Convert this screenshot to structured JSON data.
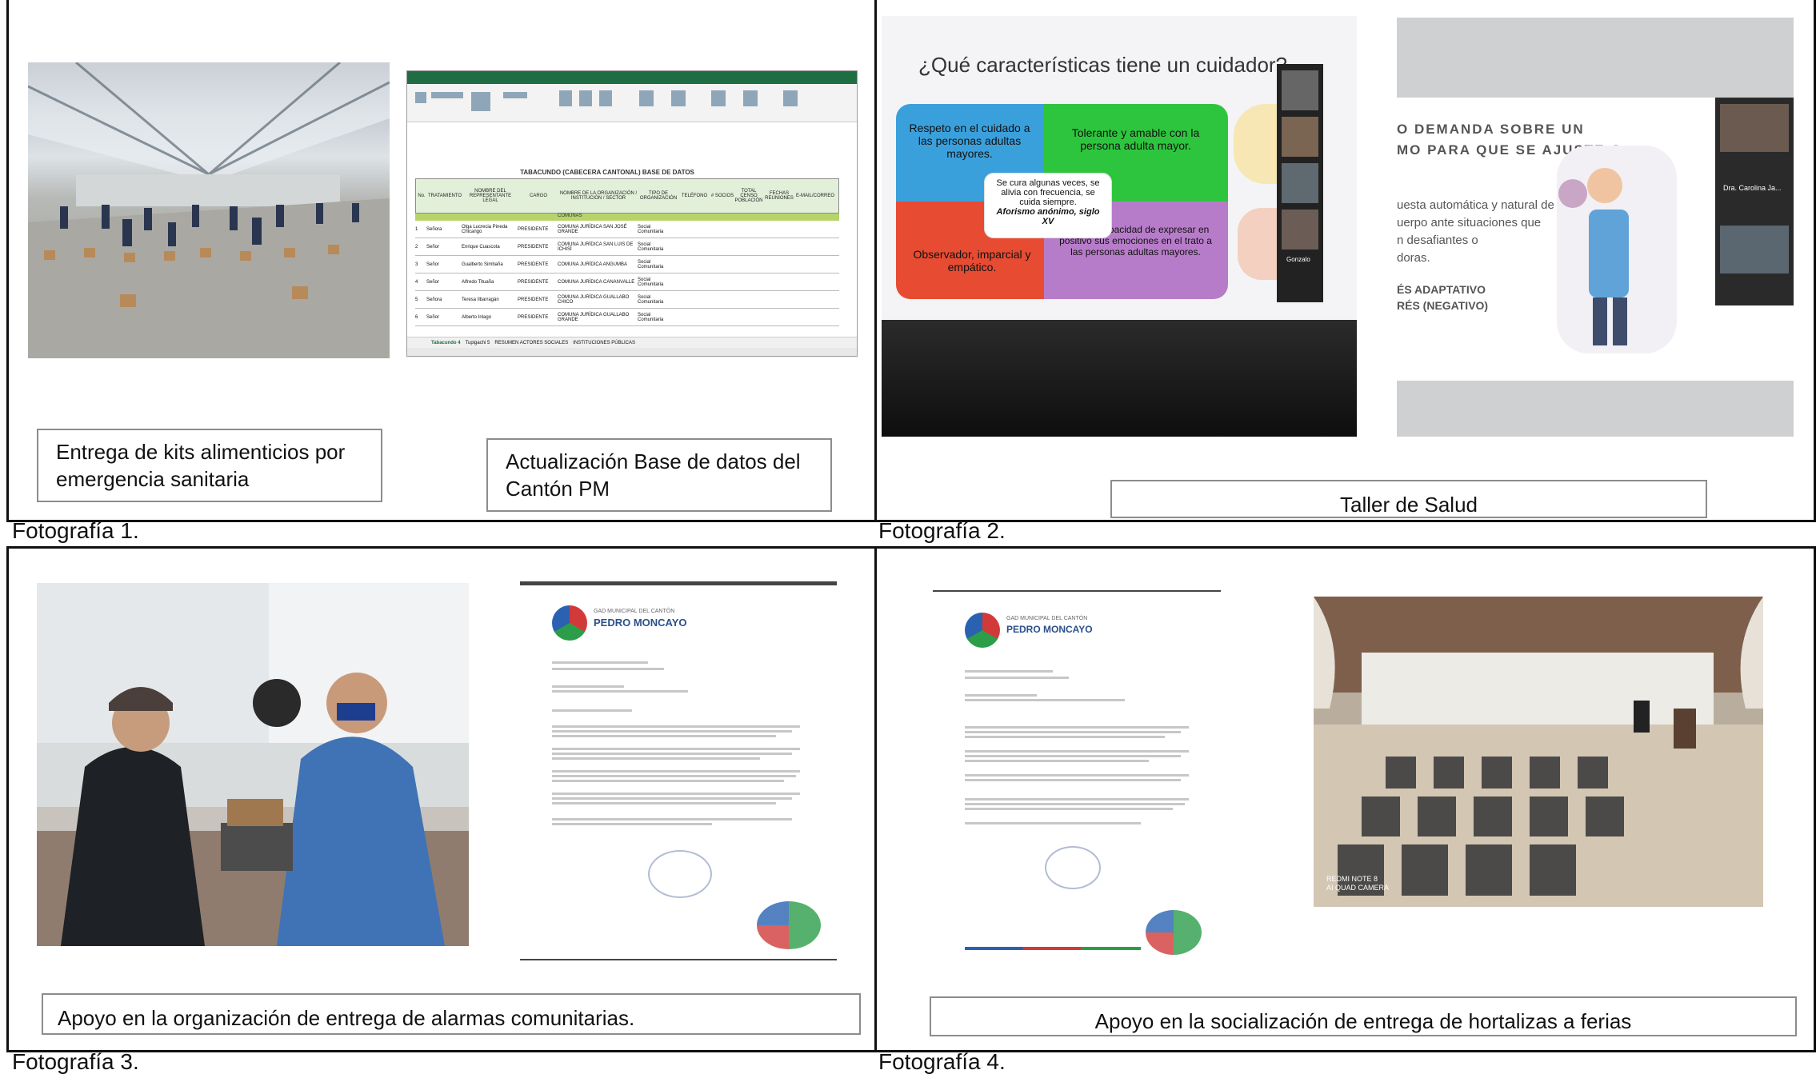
{
  "figures": [
    {
      "label": "Fotografía 1.",
      "captions": [
        "Entrega de kits alimenticios por emergencia sanitaria",
        "Actualización Base de datos del Cantón PM"
      ],
      "spreadsheet": {
        "title": "TABACUNDO (CABECERA CANTONAL) BASE DE DATOS",
        "headers": [
          "No.",
          "TRATAMIENTO",
          "NOMBRE DEL REPRESENTANTE LEGAL",
          "CARGO",
          "NOMBRE DE LA ORGANIZACIÓN / INSTITUCIÓN / SECTOR",
          "TIPO DE ORGANIZACIÓN",
          "TELÉFONO",
          "# SOCIOS",
          "TOTAL CENSO POBLACIÓN",
          "FECHAS REUNIONES",
          "E-MAIL/CORREO"
        ],
        "section": "COMUNAS",
        "rows": [
          [
            "1",
            "Señora",
            "Olga Lucrecia Pineda Chicango",
            "PRESIDENTE",
            "COMUNA JURÍDICA SAN JOSÉ GRANDE",
            "Social Comunitaria"
          ],
          [
            "2",
            "Señor",
            "Enrique Cuascota",
            "PRESIDENTE",
            "COMUNA JURÍDICA SAN LUIS DE ICHISÍ",
            "Social Comunitaria"
          ],
          [
            "3",
            "Señor",
            "Gualberto Simbaña",
            "PRESIDENTE",
            "COMUNA JURÍDICA ANGUMBA",
            "Social Comunitaria"
          ],
          [
            "4",
            "Señor",
            "Alfredo Tituaña",
            "PRESIDENTE",
            "COMUNA JURÍDICA CANANVALLE",
            "Social Comunitaria"
          ],
          [
            "5",
            "Señora",
            "Teresa Ilbarragán",
            "PRESIDENTE",
            "COMUNA JURÍDICA GUALLABO CHICO",
            "Social Comunitaria"
          ],
          [
            "6",
            "Señor",
            "Alberto Inlago",
            "PRESIDENTE",
            "COMUNA JURÍDICA GUALLABO GRANDE",
            "Social Comunitaria"
          ]
        ],
        "tabs": [
          "Tabacundo 4",
          "Tupigachi 5",
          "RESUMEN ACTORES SOCIALES",
          "INSTITUCIONES PÚBLICAS"
        ]
      }
    },
    {
      "label": "Fotografía 2.",
      "captions": [
        "Taller de Salud"
      ],
      "slide": {
        "title": "¿Qué características tiene un cuidador?",
        "quadrants": [
          "Respeto en el cuidado a las personas adultas mayores.",
          "Tolerante y amable con la persona adulta mayor.",
          "Observador, imparcial y empático.",
          "Tiene la capacidad de expresar en positivo sus emociones en el trato a las personas adultas mayores."
        ],
        "center_text": "Se cura algunas veces, se alivia con frecuencia, se cuida siempre.",
        "center_source": "Aforismo anónimo, siglo XV",
        "participant": "Gonzalo"
      },
      "slide2": {
        "lines": [
          "O DEMANDA SOBRE UN",
          "MO PARA QUE SE AJUSTE O",
          "uesta automática y natural de",
          "uerpo ante situaciones que",
          "n desafiantes o",
          "doras.",
          "ÉS ADAPTATIVO",
          "RÉS (NEGATIVO)"
        ],
        "participants": [
          "Dra. Carolina Ja..."
        ]
      }
    },
    {
      "label": "Fotografía 3.",
      "captions": [
        "Apoyo en la organización de entrega de alarmas comunitarias."
      ],
      "letter": {
        "org": "GAD MUNICIPAL DEL CANTÓN",
        "name": "PEDRO MONCAYO"
      }
    },
    {
      "label": "Fotografía 4.",
      "captions": [
        "Apoyo en la socialización de entrega de hortalizas a ferias"
      ],
      "letter": {
        "org": "GAD MUNICIPAL DEL CANTÓN",
        "name": "PEDRO MONCAYO"
      },
      "camera_watermark": [
        "REDMI NOTE 8",
        "AI QUAD CAMERA"
      ]
    }
  ]
}
